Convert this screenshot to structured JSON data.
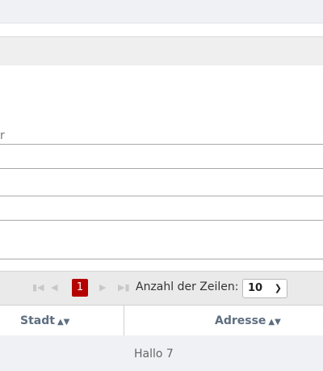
{
  "form": {
    "partial_label": "r"
  },
  "pager": {
    "current_page": "1",
    "first_icon": "first-page-icon",
    "prev_icon": "prev-page-icon",
    "next_icon": "next-page-icon",
    "last_icon": "last-page-icon",
    "rows_label": "Anzahl der Zeilen:",
    "rows_value": "10",
    "accent_color": "#b50000"
  },
  "table": {
    "columns": [
      "Stadt",
      "Adresse"
    ],
    "rows": [
      {
        "stadt": "",
        "adresse": "Hallo 7"
      }
    ]
  }
}
